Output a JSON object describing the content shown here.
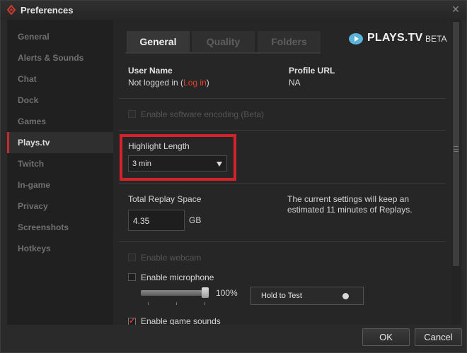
{
  "window": {
    "title": "Preferences"
  },
  "sidebar": {
    "items": [
      {
        "label": "General"
      },
      {
        "label": "Alerts & Sounds"
      },
      {
        "label": "Chat"
      },
      {
        "label": "Dock"
      },
      {
        "label": "Games"
      },
      {
        "label": "Plays.tv",
        "active": true
      },
      {
        "label": "Twitch"
      },
      {
        "label": "In-game"
      },
      {
        "label": "Privacy"
      },
      {
        "label": "Screenshots"
      },
      {
        "label": "Hotkeys"
      }
    ]
  },
  "tabs": [
    {
      "label": "General",
      "active": true
    },
    {
      "label": "Quality",
      "active": false
    },
    {
      "label": "Folders",
      "active": false
    }
  ],
  "brand": {
    "name": "PLAYS.TV",
    "suffix": "BETA"
  },
  "account": {
    "user_name_label": "User Name",
    "user_status": "Not logged in (",
    "login_link": "Log in",
    "user_status_end": ")",
    "profile_url_label": "Profile URL",
    "profile_url_value": "NA"
  },
  "software_encoding": {
    "label": "Enable software encoding (Beta)",
    "checked": false,
    "enabled": false
  },
  "highlight": {
    "label": "Highlight Length",
    "value": "3 min"
  },
  "replay_space": {
    "label": "Total Replay Space",
    "value": "4.35",
    "unit": "GB",
    "note_line1": "The current settings will keep an",
    "note_line2": "estimated 11 minutes of Replays."
  },
  "webcam": {
    "label": "Enable webcam",
    "checked": false,
    "enabled": false
  },
  "microphone": {
    "label": "Enable microphone",
    "checked": false,
    "volume_level": 1.0,
    "volume_text": "100%",
    "test_button": "Hold to Test"
  },
  "game_sounds": {
    "label": "Enable game sounds",
    "checked": true
  },
  "footer": {
    "ok_label": "OK",
    "cancel_label": "Cancel"
  },
  "colors": {
    "accent": "#d3222a",
    "link": "#e0402d",
    "brand_blue": "#5ab4d8"
  }
}
